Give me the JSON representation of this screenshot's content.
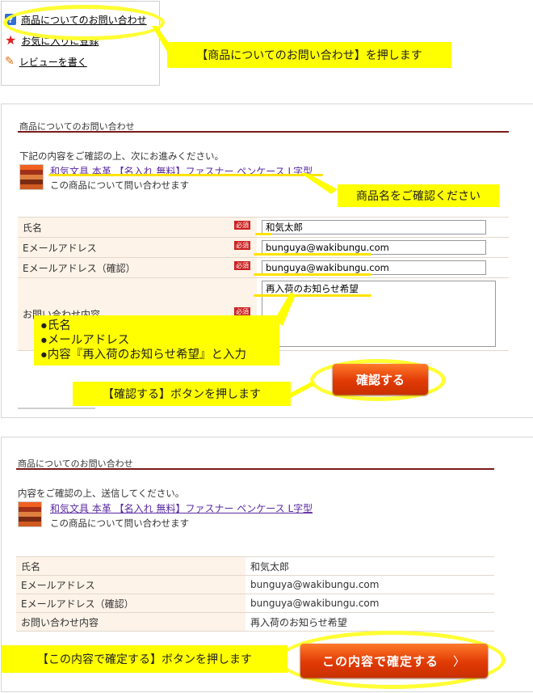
{
  "panel1": {
    "links": [
      {
        "label": "商品についてのお問い合わせ",
        "icon": "help-icon"
      },
      {
        "label": "お気に入りに登録",
        "icon": "star-icon"
      },
      {
        "label": "レビューを書く",
        "icon": "pencil-icon"
      }
    ],
    "callout": "【商品についてのお問い合わせ】を押します"
  },
  "panel2": {
    "section_title": "商品についてのお問い合わせ",
    "intro": "下記の内容をご確認の上、次にお進みください。",
    "product_name": "和気文具 本革 【名入れ 無料】ファスナー ペンケース L字型",
    "product_sub": "この商品について問い合わせます",
    "callout_product": "商品名をご確認ください",
    "required_badge": "必須",
    "fields": [
      {
        "label": "氏名",
        "value": "和気太郎"
      },
      {
        "label": "Eメールアドレス",
        "value": "bunguya@wakibungu.com"
      },
      {
        "label": "Eメールアドレス（確認）",
        "value": "bunguya@wakibungu.com"
      },
      {
        "label": "お問い合わせ内容",
        "value": "再入荷のお知らせ希望"
      }
    ],
    "callout_inputs": [
      "●氏名",
      "●メールアドレス",
      "●内容『再入荷のお知らせ希望』と入力"
    ],
    "confirm_button": "確認する",
    "callout_button": "【確認する】ボタンを押します"
  },
  "panel3": {
    "section_title": "商品についてのお問い合わせ",
    "intro": "内容をご確認の上、送信してください。",
    "product_name": "和気文具 本革 【名入れ 無料】ファスナー ペンケース L字型",
    "product_sub": "この商品について問い合わせます",
    "rows": [
      {
        "label": "氏名",
        "value": "和気太郎"
      },
      {
        "label": "Eメールアドレス",
        "value": "bunguya@wakibungu.com"
      },
      {
        "label": "Eメールアドレス（確認）",
        "value": "bunguya@wakibungu.com"
      },
      {
        "label": "お問い合わせ内容",
        "value": "再入荷のお知らせ希望"
      }
    ],
    "submit_button": "この内容で確定する",
    "submit_chevron": "〉",
    "callout": "【この内容で確定する】ボタンを押します"
  },
  "colors": {
    "callout": "#ffff00",
    "accent": "#e13a05",
    "rule": "#7b1b1b",
    "label_bg": "#fdf3e8"
  }
}
